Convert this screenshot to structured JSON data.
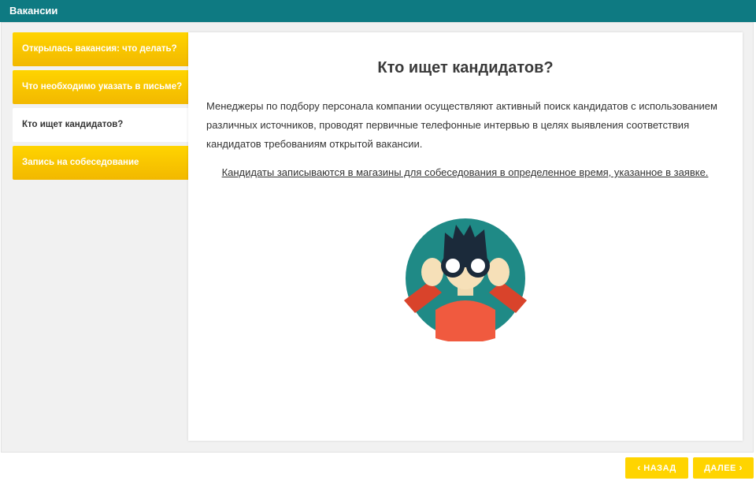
{
  "window": {
    "title": "Вакансии"
  },
  "tabs": [
    {
      "label": "Открылась вакансия: что делать?",
      "active": false
    },
    {
      "label": "Что необходимо указать в письме?",
      "active": false
    },
    {
      "label": "Кто ищет кандидатов?",
      "active": true
    },
    {
      "label": "Запись на собеседование",
      "active": false
    }
  ],
  "content": {
    "title": "Кто ищет кандидатов?",
    "paragraph": "Менеджеры по подбору персонала компании осуществляют активный поиск кандидатов с использованием различных источников, проводят первичные телефонные интервью в целях выявления соответствия кандидатов требованиям открытой вакансии.",
    "link_text": "Кандидаты записываются в магазины для собеседования в определенное время, указанное в заявке."
  },
  "navigation": {
    "back_label": "НАЗАД",
    "next_label": "ДАЛЕЕ"
  },
  "icons": {
    "illustration": "person-binoculars-illustration",
    "back": "chevron-left-icon",
    "next": "chevron-right-icon"
  },
  "colors": {
    "titlebar": "#0e7a82",
    "tab": "#ffd400",
    "illustration_circle": "#1f8a86",
    "sweater": "#f05a3f"
  }
}
